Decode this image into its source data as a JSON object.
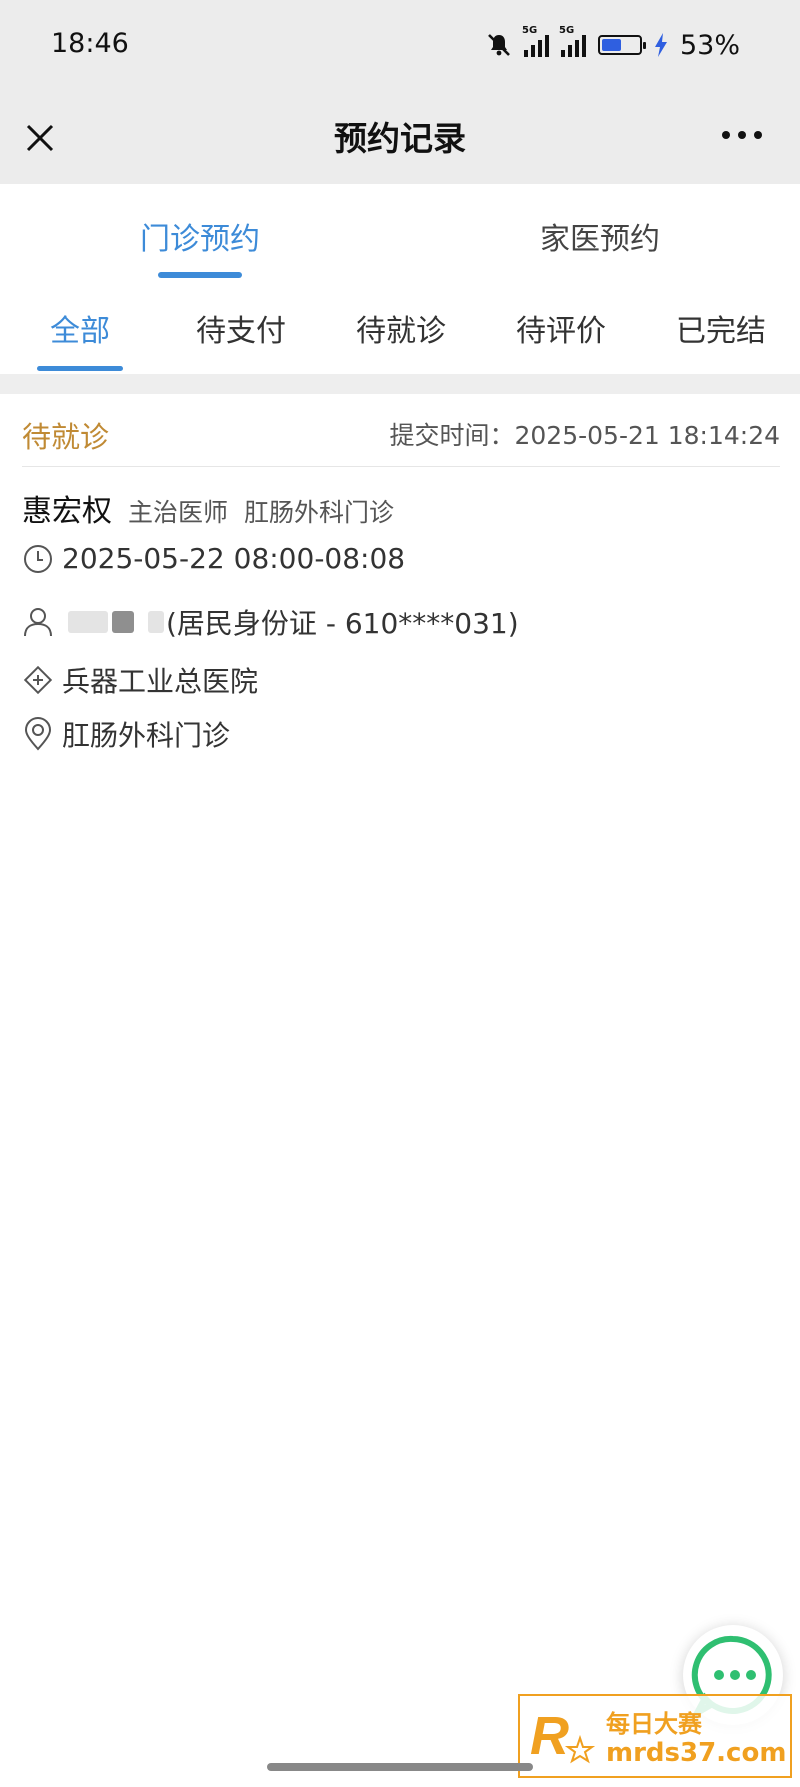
{
  "status_bar": {
    "time": "18:46",
    "network1": "5G",
    "network2": "5G",
    "battery": "53%",
    "battery_level": 0.53
  },
  "nav": {
    "title": "预约记录",
    "close_icon": "close-icon",
    "more_icon": "more-icon"
  },
  "primary_tabs": [
    {
      "label": "门诊预约",
      "active": true
    },
    {
      "label": "家医预约",
      "active": false
    }
  ],
  "status_tabs": [
    {
      "label": "全部",
      "active": true
    },
    {
      "label": "待支付",
      "active": false
    },
    {
      "label": "待就诊",
      "active": false
    },
    {
      "label": "待评价",
      "active": false
    },
    {
      "label": "已完结",
      "active": false
    }
  ],
  "appointment": {
    "status": "待就诊",
    "submit_time": "提交时间：2025-05-21 18:14:24",
    "doctor_name": "惠宏权",
    "doctor_title": "主治医师",
    "department": "肛肠外科门诊",
    "time_slot": "2025-05-22 08:00-08:08",
    "patient_id": "(居民身份证 - 610****031)",
    "hospital": "兵器工业总医院",
    "location": "肛肠外科门诊"
  },
  "watermark": {
    "line1": "每日大赛",
    "line2": "mrds37.com"
  },
  "colors": {
    "accent": "#3d8bd8",
    "status": "#c08a34",
    "watermark": "#f0a020",
    "chat": "#2fbf71"
  }
}
